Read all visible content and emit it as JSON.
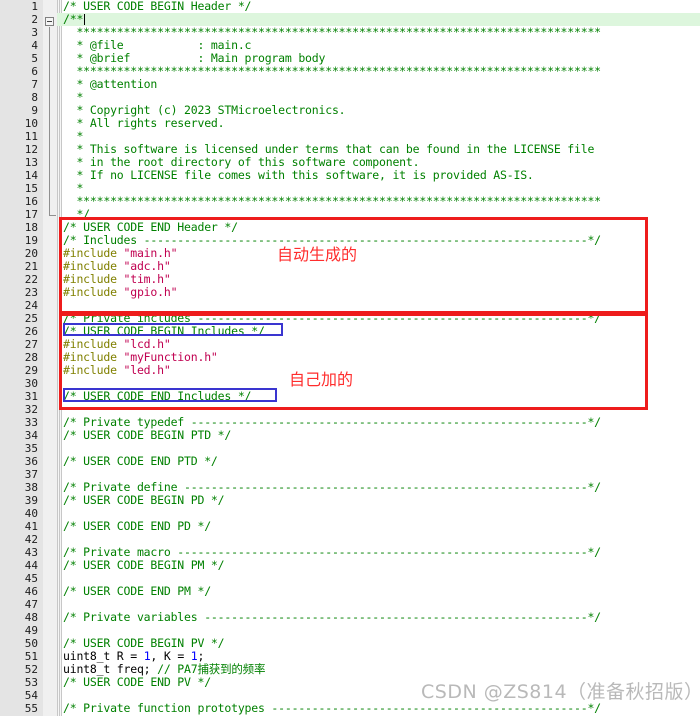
{
  "editor": {
    "title": "main.c source editor",
    "first_line": 1,
    "last_line": 55,
    "current_line": 2,
    "colors": {
      "comment": "#008000",
      "preprocessor": "#808000",
      "string": "#c00050",
      "number": "#0000ff",
      "plain": "#000000",
      "gutter_bg": "#e4e4e4",
      "current_line_bg": "#ddf6dd",
      "annotation_red": "#ee1c1c",
      "annotation_blue": "#3a35d0",
      "watermark": "#b9b9b9"
    }
  },
  "lines": [
    {
      "n": 1,
      "tokens": [
        {
          "t": "/* USER CODE BEGIN Header */",
          "c": "cm"
        }
      ]
    },
    {
      "n": 2,
      "tokens": [
        {
          "t": "/**",
          "c": "cm"
        }
      ],
      "current": true,
      "caret": true
    },
    {
      "n": 3,
      "tokens": [
        {
          "t": "  ******************************************************************************",
          "c": "cm"
        }
      ]
    },
    {
      "n": 4,
      "tokens": [
        {
          "t": "  * @file           : main.c",
          "c": "cm"
        }
      ]
    },
    {
      "n": 5,
      "tokens": [
        {
          "t": "  * @brief          : Main program body",
          "c": "cm"
        }
      ]
    },
    {
      "n": 6,
      "tokens": [
        {
          "t": "  ******************************************************************************",
          "c": "cm"
        }
      ]
    },
    {
      "n": 7,
      "tokens": [
        {
          "t": "  * @attention",
          "c": "cm"
        }
      ]
    },
    {
      "n": 8,
      "tokens": [
        {
          "t": "  *",
          "c": "cm"
        }
      ]
    },
    {
      "n": 9,
      "tokens": [
        {
          "t": "  * Copyright (c) 2023 STMicroelectronics.",
          "c": "cm"
        }
      ]
    },
    {
      "n": 10,
      "tokens": [
        {
          "t": "  * All rights reserved.",
          "c": "cm"
        }
      ]
    },
    {
      "n": 11,
      "tokens": [
        {
          "t": "  *",
          "c": "cm"
        }
      ]
    },
    {
      "n": 12,
      "tokens": [
        {
          "t": "  * This software is licensed under terms that can be found in the LICENSE file",
          "c": "cm"
        }
      ]
    },
    {
      "n": 13,
      "tokens": [
        {
          "t": "  * in the root directory of this software component.",
          "c": "cm"
        }
      ]
    },
    {
      "n": 14,
      "tokens": [
        {
          "t": "  * If no LICENSE file comes with this software, it is provided AS-IS.",
          "c": "cm"
        }
      ]
    },
    {
      "n": 15,
      "tokens": [
        {
          "t": "  *",
          "c": "cm"
        }
      ]
    },
    {
      "n": 16,
      "tokens": [
        {
          "t": "  ******************************************************************************",
          "c": "cm"
        }
      ]
    },
    {
      "n": 17,
      "tokens": [
        {
          "t": "  */",
          "c": "cm"
        }
      ]
    },
    {
      "n": 18,
      "tokens": [
        {
          "t": "/* USER CODE END Header */",
          "c": "cm"
        }
      ]
    },
    {
      "n": 19,
      "tokens": [
        {
          "t": "/* Includes ------------------------------------------------------------------*/",
          "c": "cm"
        }
      ]
    },
    {
      "n": 20,
      "tokens": [
        {
          "t": "#include ",
          "c": "pp"
        },
        {
          "t": "\"main.h\"",
          "c": "str"
        }
      ]
    },
    {
      "n": 21,
      "tokens": [
        {
          "t": "#include ",
          "c": "pp"
        },
        {
          "t": "\"adc.h\"",
          "c": "str"
        }
      ]
    },
    {
      "n": 22,
      "tokens": [
        {
          "t": "#include ",
          "c": "pp"
        },
        {
          "t": "\"tim.h\"",
          "c": "str"
        }
      ]
    },
    {
      "n": 23,
      "tokens": [
        {
          "t": "#include ",
          "c": "pp"
        },
        {
          "t": "\"gpio.h\"",
          "c": "str"
        }
      ]
    },
    {
      "n": 24,
      "tokens": []
    },
    {
      "n": 25,
      "tokens": [
        {
          "t": "/* Private includes ----------------------------------------------------------*/",
          "c": "cm"
        }
      ]
    },
    {
      "n": 26,
      "tokens": [
        {
          "t": "/* USER CODE BEGIN Includes */",
          "c": "cm"
        }
      ]
    },
    {
      "n": 27,
      "tokens": [
        {
          "t": "#include ",
          "c": "pp"
        },
        {
          "t": "\"lcd.h\"",
          "c": "str"
        }
      ]
    },
    {
      "n": 28,
      "tokens": [
        {
          "t": "#include ",
          "c": "pp"
        },
        {
          "t": "\"myFunction.h\"",
          "c": "str"
        }
      ]
    },
    {
      "n": 29,
      "tokens": [
        {
          "t": "#include ",
          "c": "pp"
        },
        {
          "t": "\"led.h\"",
          "c": "str"
        }
      ]
    },
    {
      "n": 30,
      "tokens": []
    },
    {
      "n": 31,
      "tokens": [
        {
          "t": "/* USER CODE END Includes */",
          "c": "cm"
        }
      ]
    },
    {
      "n": 32,
      "tokens": []
    },
    {
      "n": 33,
      "tokens": [
        {
          "t": "/* Private typedef -----------------------------------------------------------*/",
          "c": "cm"
        }
      ]
    },
    {
      "n": 34,
      "tokens": [
        {
          "t": "/* USER CODE BEGIN PTD */",
          "c": "cm"
        }
      ]
    },
    {
      "n": 35,
      "tokens": []
    },
    {
      "n": 36,
      "tokens": [
        {
          "t": "/* USER CODE END PTD */",
          "c": "cm"
        }
      ]
    },
    {
      "n": 37,
      "tokens": []
    },
    {
      "n": 38,
      "tokens": [
        {
          "t": "/* Private define ------------------------------------------------------------*/",
          "c": "cm"
        }
      ]
    },
    {
      "n": 39,
      "tokens": [
        {
          "t": "/* USER CODE BEGIN PD */",
          "c": "cm"
        }
      ]
    },
    {
      "n": 40,
      "tokens": []
    },
    {
      "n": 41,
      "tokens": [
        {
          "t": "/* USER CODE END PD */",
          "c": "cm"
        }
      ]
    },
    {
      "n": 42,
      "tokens": []
    },
    {
      "n": 43,
      "tokens": [
        {
          "t": "/* Private macro -------------------------------------------------------------*/",
          "c": "cm"
        }
      ]
    },
    {
      "n": 44,
      "tokens": [
        {
          "t": "/* USER CODE BEGIN PM */",
          "c": "cm"
        }
      ]
    },
    {
      "n": 45,
      "tokens": []
    },
    {
      "n": 46,
      "tokens": [
        {
          "t": "/* USER CODE END PM */",
          "c": "cm"
        }
      ]
    },
    {
      "n": 47,
      "tokens": []
    },
    {
      "n": 48,
      "tokens": [
        {
          "t": "/* Private variables ---------------------------------------------------------*/",
          "c": "cm"
        }
      ]
    },
    {
      "n": 49,
      "tokens": []
    },
    {
      "n": 50,
      "tokens": [
        {
          "t": "/* USER CODE BEGIN PV */",
          "c": "cm"
        }
      ]
    },
    {
      "n": 51,
      "tokens": [
        {
          "t": "uint8_t R = ",
          "c": "tx"
        },
        {
          "t": "1",
          "c": "num"
        },
        {
          "t": ", K = ",
          "c": "tx"
        },
        {
          "t": "1",
          "c": "num"
        },
        {
          "t": ";",
          "c": "tx"
        }
      ]
    },
    {
      "n": 52,
      "tokens": [
        {
          "t": "uint8_t freq; ",
          "c": "tx"
        },
        {
          "t": "// PA7捕获到的频率",
          "c": "cm"
        }
      ]
    },
    {
      "n": 53,
      "tokens": [
        {
          "t": "/* USER CODE END PV */",
          "c": "cm"
        }
      ]
    },
    {
      "n": 54,
      "tokens": []
    },
    {
      "n": 55,
      "tokens": [
        {
          "t": "/* Private function prototypes -----------------------------------------------*/",
          "c": "cm"
        }
      ]
    }
  ],
  "annotations": {
    "auto_generated_label": "自动生成的",
    "self_added_label": "自己加的",
    "watermark": "CSDN @ZS814（准备秋招版）"
  },
  "folding": {
    "collapse_line": 2,
    "region_end_line": 17,
    "marker": "minus"
  }
}
